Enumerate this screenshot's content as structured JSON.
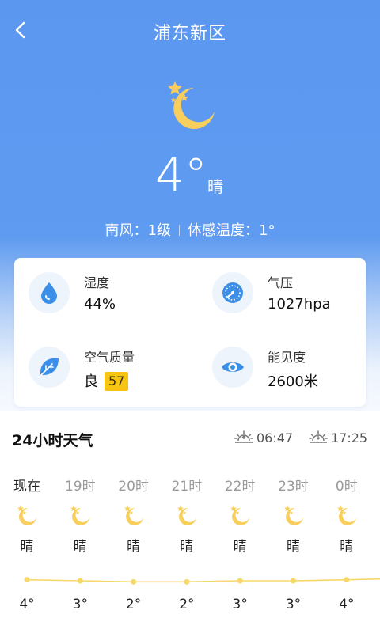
{
  "header": {
    "title": "浦东新区",
    "back_icon": "chevron-left-icon"
  },
  "current": {
    "icon": "moon-stars-icon",
    "temperature": "4°",
    "condition": "晴",
    "wind": "南风：1级",
    "feels_like": "体感温度：1°"
  },
  "details": {
    "humidity": {
      "label": "湿度",
      "value": "44%",
      "icon": "water-drop-icon"
    },
    "pressure": {
      "label": "气压",
      "value": "1027hpa",
      "icon": "gauge-icon"
    },
    "air_quality": {
      "label": "空气质量",
      "value": "良",
      "aqi": "57",
      "icon": "leaf-icon",
      "badge_color": "#f6c513"
    },
    "visibility": {
      "label": "能见度",
      "value": "2600米",
      "icon": "eye-icon"
    }
  },
  "hourly": {
    "title": "24小时天气",
    "sunrise": "06:47",
    "sunset": "17:25",
    "hours": [
      {
        "label": "现在",
        "condition": "晴",
        "temp": "4°",
        "t": 4
      },
      {
        "label": "19时",
        "condition": "晴",
        "temp": "3°",
        "t": 3
      },
      {
        "label": "20时",
        "condition": "晴",
        "temp": "2°",
        "t": 2
      },
      {
        "label": "21时",
        "condition": "晴",
        "temp": "2°",
        "t": 2
      },
      {
        "label": "22时",
        "condition": "晴",
        "temp": "3°",
        "t": 3
      },
      {
        "label": "23时",
        "condition": "晴",
        "temp": "3°",
        "t": 3
      },
      {
        "label": "0时",
        "condition": "晴",
        "temp": "4°",
        "t": 4
      }
    ]
  },
  "colors": {
    "sky_blue": "#5b97ef",
    "moon_yellow": "#f8cf5c",
    "curve_yellow": "#f6d76a",
    "icon_blue": "#3b8fe8"
  }
}
